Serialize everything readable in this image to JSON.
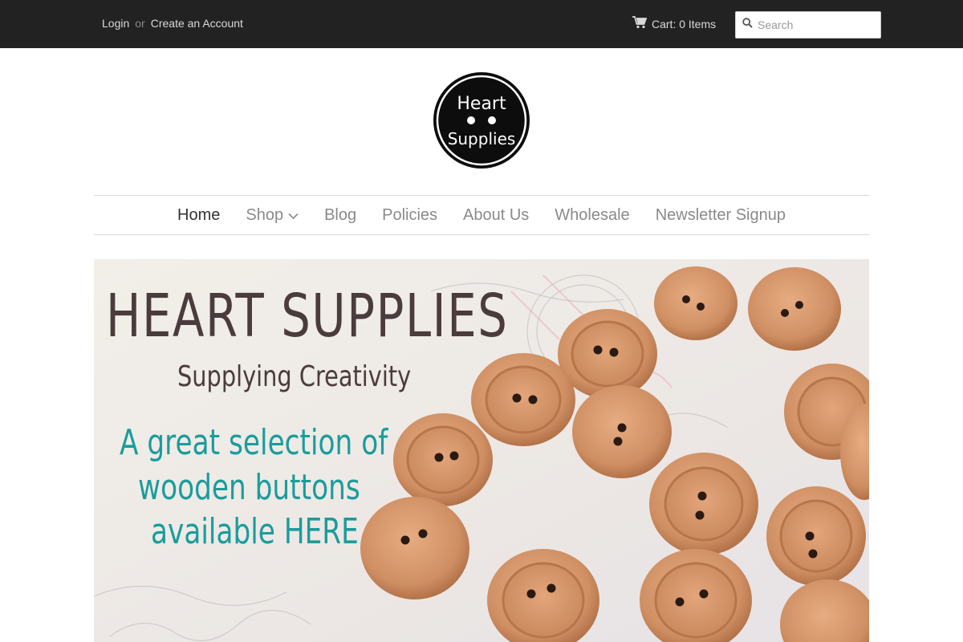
{
  "topbar": {
    "login_label": "Login",
    "or_label": "or",
    "create_account_label": "Create an Account",
    "cart_label": "Cart: 0 Items",
    "search_placeholder": "Search",
    "search_value": ""
  },
  "logo": {
    "line1": "Heart",
    "line2": "Supplies"
  },
  "nav": {
    "items": [
      {
        "label": "Home",
        "active": true
      },
      {
        "label": "Shop",
        "has_dropdown": true
      },
      {
        "label": "Blog"
      },
      {
        "label": "Policies"
      },
      {
        "label": "About Us"
      },
      {
        "label": "Wholesale"
      },
      {
        "label": "Newsletter Signup"
      }
    ]
  },
  "hero": {
    "title": "HEART SUPPLIES",
    "subtitle": "Supplying Creativity",
    "line1": "A great selection of",
    "line2": "wooden buttons",
    "line3": "available HERE"
  },
  "colors": {
    "topbar_bg": "#222222",
    "nav_active": "#333333",
    "nav_inactive": "#8a8a8a",
    "hero_dark_text": "#4a3c3c",
    "hero_teal_text": "#1a9c9c",
    "button_wood": "#c98a5e"
  },
  "icons": {
    "cart": "shopping-cart-icon",
    "search": "search-icon",
    "shop_dropdown": "chevron-down-icon"
  }
}
